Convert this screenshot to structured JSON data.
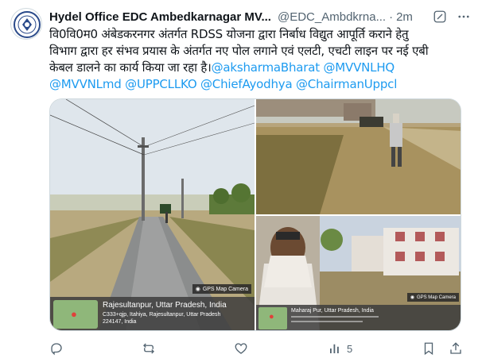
{
  "tweet": {
    "author_name": "Hydel Office EDC Ambedkarnagar MV...",
    "author_handle": "@EDC_Ambdkrna...",
    "separator": "·",
    "time": "2m",
    "text_lines": [
      "वि0वि0म0 अंबेडकरनगर अंतर्गत RDSS योजना द्वारा निर्बाध विद्युत आपूर्ति कराने हेतु",
      "विभाग द्वारा हर संभव प्रयास के अंतर्गत नए पोल लगाने एवं एलटी, एचटी लाइन पर नई एबी",
      "केबल डालने का कार्य किया जा रहा है।"
    ],
    "mentions_line3": "@aksharmaBharat @MVVNLHQ",
    "mentions_line4": "@MVVNLmd @UPPCLLKO @ChiefAyodhya @ChairmanUppcl"
  },
  "photos": {
    "p1": {
      "badge": "GPS Map Camera",
      "location": "Rajesultanpur, Uttar Pradesh, India",
      "address_1": "C333+qjp, Itahiya, Rajesultanpur, Uttar Pradesh",
      "address_2": "224147, India"
    },
    "p3": {
      "badge": "GPS Map Camera",
      "location": "Maharaj Pur, Uttar Pradesh, India"
    }
  },
  "actions": {
    "views_count": "5"
  },
  "colors": {
    "link": "#1d9bf0",
    "secondary": "#536471",
    "border": "#cfd9de"
  },
  "icons": [
    "grok-icon",
    "more-icon",
    "reply-icon",
    "retweet-icon",
    "like-icon",
    "views-icon",
    "bookmark-icon",
    "share-icon"
  ]
}
